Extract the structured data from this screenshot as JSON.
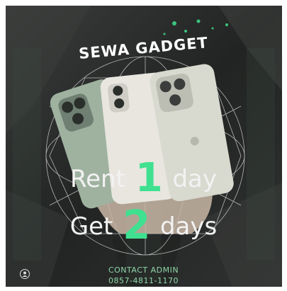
{
  "title": "SEWA GADGET",
  "slogan": {
    "line1_before": "Rent",
    "line1_number": "1",
    "line1_after": "day",
    "line2_before": "Get",
    "line2_number": "2",
    "line2_after": "days"
  },
  "contact": {
    "label": "CONTACT ADMIN",
    "phone": "0857-4811-1170"
  },
  "colors": {
    "accent_green": "#3fe08f",
    "background": "#2a2c2b",
    "contact_text": "#8fd6a9"
  },
  "icons": {
    "profile": "user-icon"
  }
}
